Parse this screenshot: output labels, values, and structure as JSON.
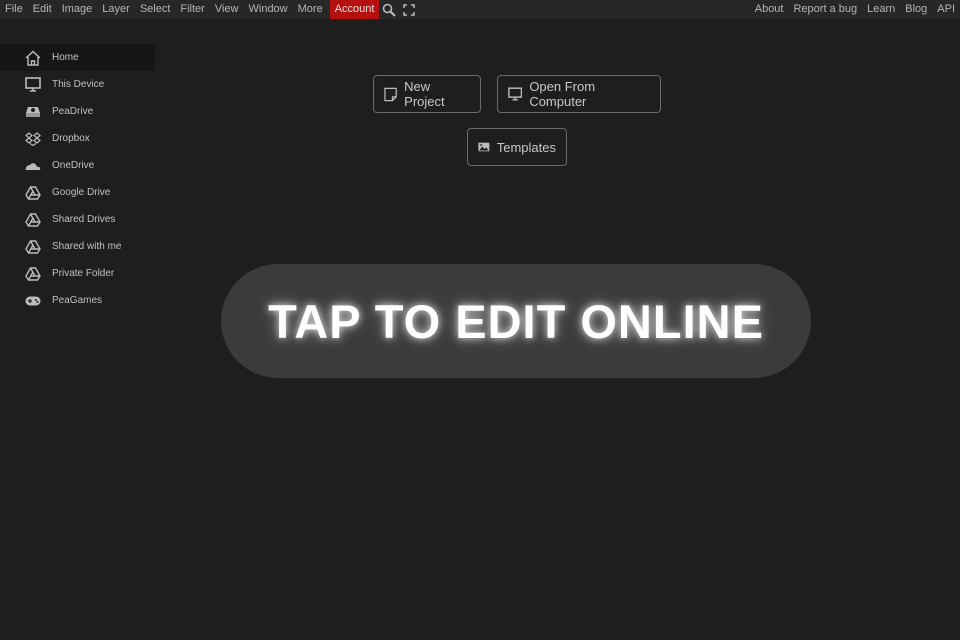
{
  "menu": [
    "File",
    "Edit",
    "Image",
    "Layer",
    "Select",
    "Filter",
    "View",
    "Window",
    "More"
  ],
  "account": "Account",
  "right_links": [
    "About",
    "Report a bug",
    "Learn",
    "Blog",
    "API"
  ],
  "sidebar": [
    {
      "label": "Home",
      "icon": "home-icon"
    },
    {
      "label": "This Device",
      "icon": "monitor-icon"
    },
    {
      "label": "PeaDrive",
      "icon": "drive-icon"
    },
    {
      "label": "Dropbox",
      "icon": "dropbox-icon"
    },
    {
      "label": "OneDrive",
      "icon": "cloud-icon"
    },
    {
      "label": "Google Drive",
      "icon": "google-drive-icon"
    },
    {
      "label": "Shared Drives",
      "icon": "google-drive-icon"
    },
    {
      "label": "Shared with me",
      "icon": "google-drive-icon"
    },
    {
      "label": "Private Folder",
      "icon": "google-drive-icon"
    },
    {
      "label": "PeaGames",
      "icon": "gamepad-icon"
    }
  ],
  "buttons": {
    "new_project": "New Project",
    "open": "Open From Computer",
    "templates": "Templates"
  },
  "overlay": "TAP TO EDIT ONLINE"
}
